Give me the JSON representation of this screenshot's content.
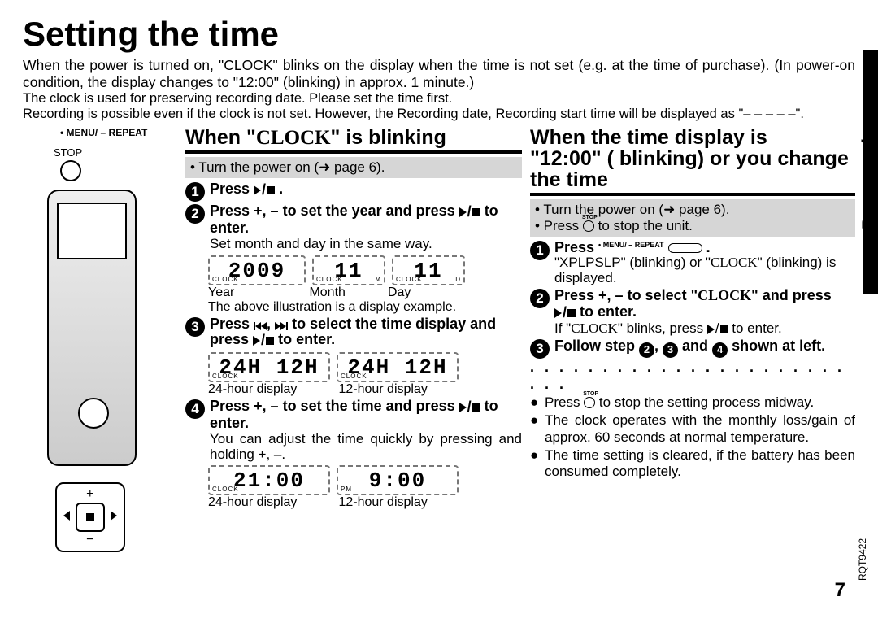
{
  "title": "Setting the time",
  "intro1": "When the power is turned on, \"CLOCK\" blinks on the display when the time is not set (e.g. at the time of purchase). (In power-on condition, the display changes to \"12:00\" (blinking) in approx. 1 minute.)",
  "intro2": "The clock is used for preserving recording date. Please set the time first.",
  "intro3": "Recording is possible even if the clock is not set. However, the Recording date, Recording start time will be displayed as \"– – – – –\".",
  "left": {
    "menuRepeat": "• MENU/ – REPEAT",
    "stop": "STOP",
    "plus": "+",
    "minus": "−"
  },
  "mid": {
    "heading_pre": "When \"",
    "heading_clock": "CLOCK",
    "heading_post": "\" is blinking",
    "gray": "• Turn the power on (➜ page 6).",
    "s1": {
      "n": "1",
      "t": "Press ",
      "after": " ."
    },
    "s2": {
      "n": "2",
      "t1": "Press +, – to set the year and press ",
      "t2": " to enter."
    },
    "s2sub": "Set month and day in the same way.",
    "lcd": {
      "year": "2009",
      "month": "11",
      "day": "11",
      "clock": "CLOCK",
      "m": "M",
      "d": "D"
    },
    "lcdCapY": "Year",
    "lcdCapM": "Month",
    "lcdCapD": "Day",
    "lcdNote": "The above illustration is a display example.",
    "s3": {
      "n": "3",
      "t1": "Press ",
      "t2": " to select the time display and press ",
      "t3": " to enter."
    },
    "lcd2a": "24H 12H",
    "lcd2b": "24H 12H",
    "lcd2capA": "24-hour display",
    "lcd2capB": "12-hour display",
    "s4": {
      "n": "4",
      "t1": "Press +, – to set the time and press ",
      "t2": " to enter."
    },
    "s4sub": "You can adjust the time quickly by pressing and holding +, –.",
    "lcd3a": "21:00",
    "lcd3b": "9:00",
    "pm": "PM",
    "lcd3capA": "24-hour display",
    "lcd3capB": "12-hour display"
  },
  "right": {
    "heading1": "When the time display is",
    "heading2_val": "\"12:00\"",
    "heading2_rest": " blinking) or you change the time",
    "heading2_open": " (",
    "gray1": "• Turn the power on (➜ page 6).",
    "gray2_pre": "• Press ",
    "gray2_post": " to stop the unit.",
    "s1": {
      "n": "1",
      "t": "Press ",
      "menuLabel": "• MENU/ – REPEAT"
    },
    "s1sub_pre": "\"XPLPSLP\" (blinking) or \"",
    "s1sub_clk": "CLOCK",
    "s1sub_post": "\" (blinking) is displayed.",
    "s2": {
      "n": "2",
      "t1": "Press +, – to select \"",
      "t2": "\" and press ",
      "t3": " to enter.",
      "clk": "CLOCK"
    },
    "s2sub_pre": "If \"",
    "s2sub_clk": "CLOCK",
    "s2sub_post": "\" blinks, press ",
    "s2sub_end": " to enter.",
    "s3": {
      "n": "3",
      "t1": "Follow step ",
      "t2": " and ",
      "t3": " shown at left."
    },
    "s3_nums": {
      "a": "2",
      "comma": ", ",
      "b": "3",
      "c": "4"
    },
    "b1_pre": "Press ",
    "b1_post": " to stop the setting process midway.",
    "b2": "The clock operates with the monthly loss/gain of approx. 60 seconds at normal temperature.",
    "b3": "The time setting is cleared, if the battery has been consumed completely."
  },
  "sideLabel": "Preparation",
  "docCode": "RQT9422",
  "pageNum": "7"
}
